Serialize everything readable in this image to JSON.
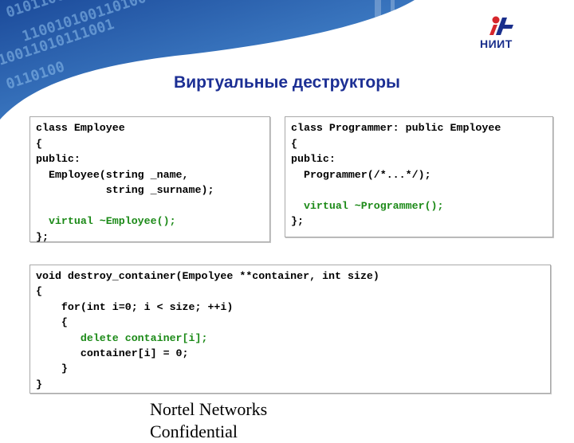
{
  "logo": {
    "mark": "it",
    "text": "НИИТ"
  },
  "slide": {
    "title": "Виртуальные деструкторы"
  },
  "code_boxes": [
    {
      "lines": [
        {
          "text": "class Employee",
          "highlight": false
        },
        {
          "text": "{",
          "highlight": false
        },
        {
          "text": "public:",
          "highlight": false
        },
        {
          "text": "  Employee(string _name,",
          "highlight": false
        },
        {
          "text": "           string _surname);",
          "highlight": false
        },
        {
          "text": "",
          "highlight": false
        },
        {
          "text": "  virtual ~Employee();",
          "highlight": true
        },
        {
          "text": "};",
          "highlight": false
        }
      ]
    },
    {
      "lines": [
        {
          "text": "class Programmer: public Employee",
          "highlight": false
        },
        {
          "text": "{",
          "highlight": false
        },
        {
          "text": "public:",
          "highlight": false
        },
        {
          "text": "  Programmer(/*...*/);",
          "highlight": false
        },
        {
          "text": "",
          "highlight": false
        },
        {
          "text": "  virtual ~Programmer();",
          "highlight": true
        },
        {
          "text": "};",
          "highlight": false
        }
      ]
    },
    {
      "lines": [
        {
          "text": "void destroy_container(Empolyee **container, int size)",
          "highlight": false
        },
        {
          "text": "{",
          "highlight": false
        },
        {
          "text": "    for(int i=0; i < size; ++i)",
          "highlight": false
        },
        {
          "text": "    {",
          "highlight": false
        },
        {
          "text": "       delete container[i];",
          "highlight": true
        },
        {
          "text": "       container[i] = 0;",
          "highlight": false
        },
        {
          "text": "    }",
          "highlight": false
        },
        {
          "text": "}",
          "highlight": false
        }
      ]
    }
  ],
  "footer": {
    "line1": "Nortel Networks",
    "line2": "Confidential"
  },
  "colors": {
    "title": "#1c2f94",
    "highlight": "#1c8a18",
    "banner": "#1f4f9e"
  }
}
